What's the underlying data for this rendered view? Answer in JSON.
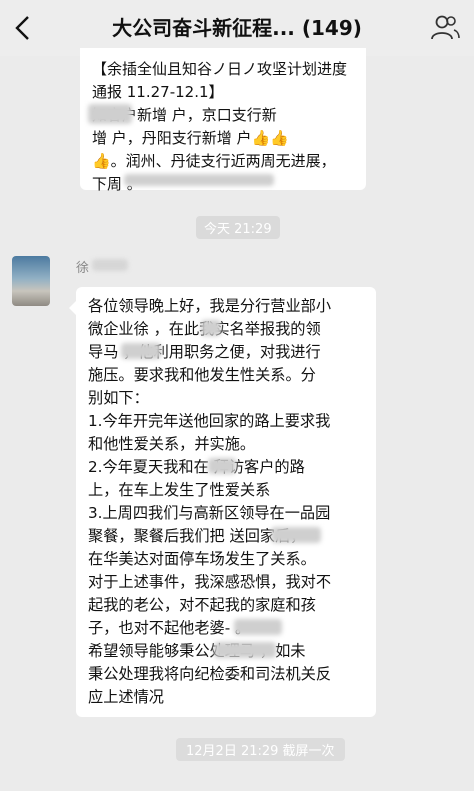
{
  "titlebar": {
    "title": "大公司奋斗新征程... (149)",
    "back_icon": "chevron-left-icon",
    "members_icon": "people-icon"
  },
  "quoted_message": {
    "lines": [
      "【余插全仙且知谷ノ日ノ攻坚计划进度",
      "通报 11.27-12.1】",
      "    知客户新增  户，京口支行新",
      "增  户，丹阳支行新增  户👍👍",
      "👍。润州、丹徒支行近两周无进展，",
      "下周                        。"
    ]
  },
  "time_divider": "今天 21:29",
  "message": {
    "sender": "徐",
    "lines": [
      "各位领导晚上好，我是分行营业部小",
      "微企业徐  ，在此我实名举报我的领",
      "导马     ，他利用职务之便，对我进行",
      "施压。要求我和他发生性关系。分",
      "别如下：",
      "1.今年开完年送他回家的路上要求我",
      "和他性爱关系，并实施。",
      "2.今年夏天我和在    拜访客户的路",
      "上，在车上发生了性爱关系",
      "3.上周四我们与高新区领导在一品园",
      "聚餐，聚餐后我们把      送回家后，",
      "在华美达对面停车场发生了关系。",
      "对于上述事件，我深感恐惧，我对不",
      "起我的老公，对不起我的家庭和孩",
      "子，也对不起他老婆-       。",
      "希望领导能够秉公处理马        ，如未",
      "秉公处理我将向纪检委和司法机关反",
      "应上述情况"
    ]
  },
  "footer_notice": "12月2日 21:29 截屏一次"
}
